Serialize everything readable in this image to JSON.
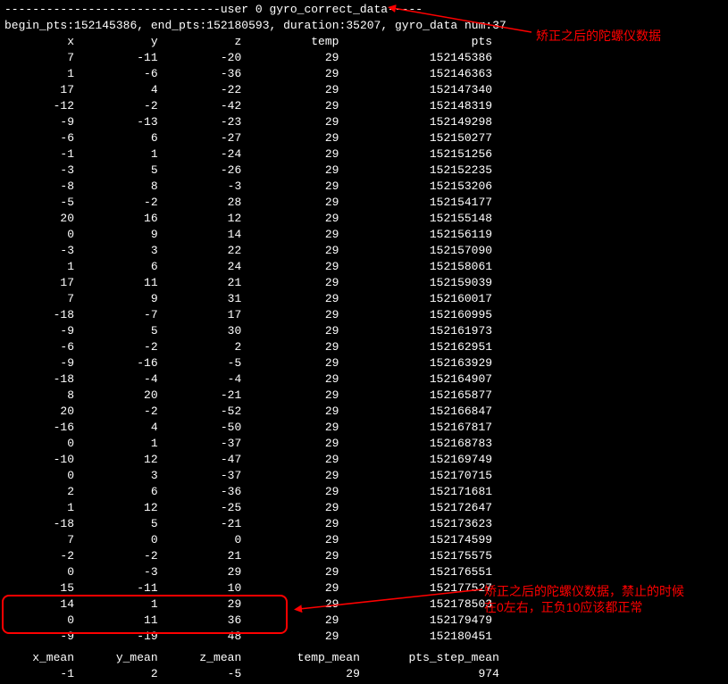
{
  "header": {
    "title": "user 0 gyro_correct_data",
    "dashes_left": "-------------------------------",
    "dashes_right": "-----"
  },
  "info": {
    "begin_pts_label": "begin_pts",
    "begin_pts": "152145386",
    "end_pts_label": "end_pts",
    "end_pts": "152180593",
    "duration_label": "duration",
    "duration": "35207",
    "gyro_data_num_label": "gyro_data num",
    "gyro_data_num": "37"
  },
  "columns": [
    "x",
    "y",
    "z",
    "temp",
    "pts"
  ],
  "chart_data": {
    "type": "table",
    "columns": [
      "x",
      "y",
      "z",
      "temp",
      "pts"
    ],
    "rows": [
      [
        7,
        -11,
        -20,
        29,
        "152145386"
      ],
      [
        1,
        -6,
        -36,
        29,
        "152146363"
      ],
      [
        17,
        4,
        -22,
        29,
        "152147340"
      ],
      [
        -12,
        -2,
        -42,
        29,
        "152148319"
      ],
      [
        -9,
        -13,
        -23,
        29,
        "152149298"
      ],
      [
        -6,
        6,
        -27,
        29,
        "152150277"
      ],
      [
        -1,
        1,
        -24,
        29,
        "152151256"
      ],
      [
        -3,
        5,
        -26,
        29,
        "152152235"
      ],
      [
        -8,
        8,
        -3,
        29,
        "152153206"
      ],
      [
        -5,
        -2,
        28,
        29,
        "152154177"
      ],
      [
        20,
        16,
        12,
        29,
        "152155148"
      ],
      [
        0,
        9,
        14,
        29,
        "152156119"
      ],
      [
        -3,
        3,
        22,
        29,
        "152157090"
      ],
      [
        1,
        6,
        24,
        29,
        "152158061"
      ],
      [
        17,
        11,
        21,
        29,
        "152159039"
      ],
      [
        7,
        9,
        31,
        29,
        "152160017"
      ],
      [
        -18,
        -7,
        17,
        29,
        "152160995"
      ],
      [
        -9,
        5,
        30,
        29,
        "152161973"
      ],
      [
        -6,
        -2,
        2,
        29,
        "152162951"
      ],
      [
        -9,
        -16,
        -5,
        29,
        "152163929"
      ],
      [
        -18,
        -4,
        -4,
        29,
        "152164907"
      ],
      [
        8,
        20,
        -21,
        29,
        "152165877"
      ],
      [
        20,
        -2,
        -52,
        29,
        "152166847"
      ],
      [
        -16,
        4,
        -50,
        29,
        "152167817"
      ],
      [
        0,
        1,
        -37,
        29,
        "152168783"
      ],
      [
        -10,
        12,
        -47,
        29,
        "152169749"
      ],
      [
        0,
        3,
        -37,
        29,
        "152170715"
      ],
      [
        2,
        6,
        -36,
        29,
        "152171681"
      ],
      [
        1,
        12,
        -25,
        29,
        "152172647"
      ],
      [
        -18,
        5,
        -21,
        29,
        "152173623"
      ],
      [
        7,
        0,
        0,
        29,
        "152174599"
      ],
      [
        -2,
        -2,
        21,
        29,
        "152175575"
      ],
      [
        0,
        -3,
        29,
        29,
        "152176551"
      ],
      [
        15,
        -11,
        10,
        29,
        "152177527"
      ],
      [
        14,
        1,
        29,
        29,
        "152178503"
      ],
      [
        0,
        11,
        36,
        29,
        "152179479"
      ],
      [
        -9,
        -19,
        48,
        29,
        "152180451"
      ]
    ]
  },
  "mean_columns": [
    "x_mean",
    "y_mean",
    "z_mean",
    "temp_mean",
    "pts_step_mean"
  ],
  "mean_values": [
    -1,
    2,
    -5,
    29,
    974
  ],
  "annotations": {
    "top": "矫正之后的陀螺仪数据",
    "bottom_line1": "矫正之后的陀螺仪数据，禁止的时候",
    "bottom_line2": "在0左右，正负10应该都正常"
  }
}
